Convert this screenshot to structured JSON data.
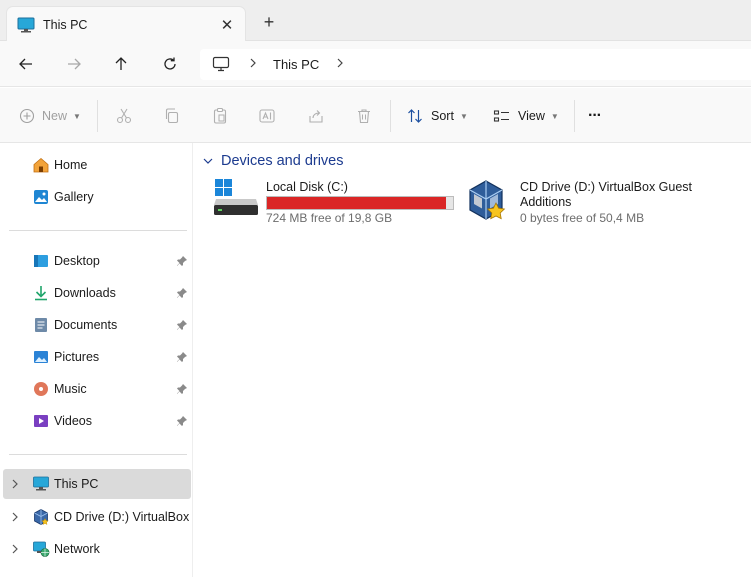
{
  "window": {
    "tab_title": "This PC",
    "close_glyph": "✕",
    "new_tab_glyph": "+"
  },
  "address": {
    "segment": "This PC"
  },
  "toolbar": {
    "new_label": "New",
    "sort_label": "Sort",
    "view_label": "View",
    "more_glyph": "···"
  },
  "sidebar": {
    "quick": [
      {
        "label": "Home",
        "icon": "home-icon"
      },
      {
        "label": "Gallery",
        "icon": "gallery-icon"
      }
    ],
    "pinned": [
      {
        "label": "Desktop",
        "icon": "desktop-icon"
      },
      {
        "label": "Downloads",
        "icon": "downloads-icon"
      },
      {
        "label": "Documents",
        "icon": "documents-icon"
      },
      {
        "label": "Pictures",
        "icon": "pictures-icon"
      },
      {
        "label": "Music",
        "icon": "music-icon"
      },
      {
        "label": "Videos",
        "icon": "videos-icon"
      }
    ],
    "tree": [
      {
        "label": "This PC",
        "icon": "this-pc-icon",
        "selected": true
      },
      {
        "label": "CD Drive (D:) VirtualBox Guest Additions",
        "icon": "virtualbox-icon"
      },
      {
        "label": "Network",
        "icon": "network-icon"
      }
    ]
  },
  "content": {
    "group_title": "Devices and drives",
    "drives": [
      {
        "name": "Local Disk (C:)",
        "free_text": "724 MB free of 19,8 GB",
        "used_fraction": 0.964,
        "bar_color": "#da2626",
        "icon": "hard-drive-icon"
      },
      {
        "name_line1": "CD Drive (D:) VirtualBox Guest",
        "name_line2": "Additions",
        "free_text": "0 bytes free of 50,4 MB",
        "icon": "virtualbox-cd-icon"
      }
    ]
  },
  "colors": {
    "accent": "#0067c0",
    "group_title": "#1c3b8f",
    "danger_bar": "#da2626",
    "selection": "#dadada"
  }
}
